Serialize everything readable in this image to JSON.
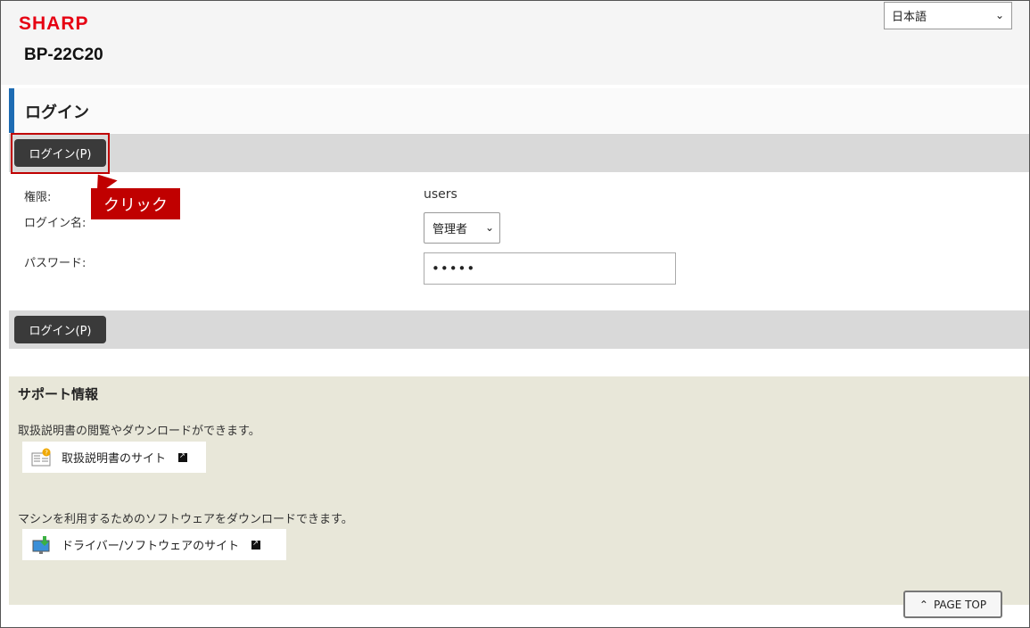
{
  "header": {
    "brand": "SHARP",
    "model": "BP-22C20",
    "language": "日本語"
  },
  "page": {
    "title": "ログイン",
    "login_button": "ログイン(P)"
  },
  "annotation": {
    "callout": "クリック"
  },
  "form": {
    "authority_label": "権限:",
    "authority_value": "users",
    "login_name_label": "ログイン名:",
    "login_name_value": "管理者",
    "password_label": "パスワード:",
    "password_value": "•••••"
  },
  "support": {
    "title": "サポート情報",
    "manual_desc": "取扱説明書の閲覧やダウンロードができます。",
    "manual_link": "取扱説明書のサイト",
    "software_desc": "マシンを利用するためのソフトウェアをダウンロードできます。",
    "software_link": "ドライバー/ソフトウェアのサイト"
  },
  "footer": {
    "page_top": "PAGE TOP"
  },
  "colors": {
    "brand": "#e60012",
    "accent": "#1e6cb3",
    "callout": "#c00000",
    "button": "#3a3a3a",
    "support_bg": "#e8e7d9"
  }
}
